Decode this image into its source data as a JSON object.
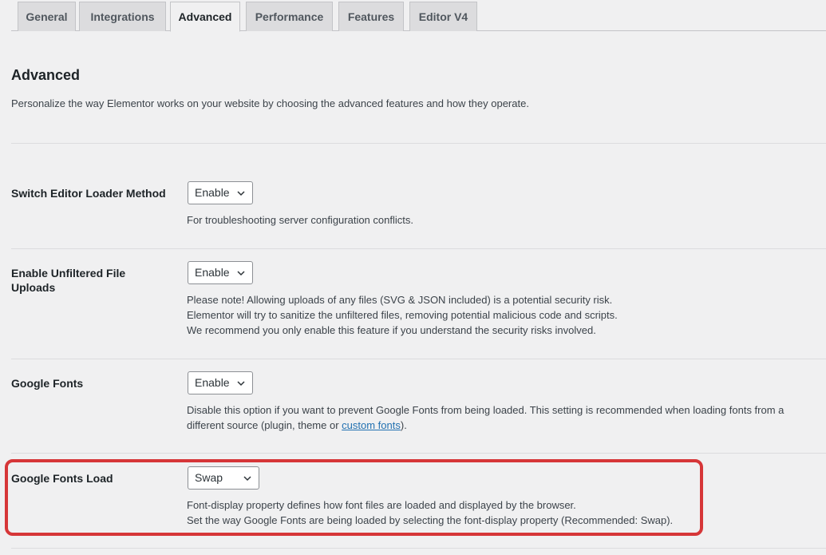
{
  "tabs": [
    {
      "label": "General"
    },
    {
      "label": "Integrations"
    },
    {
      "label": "Advanced"
    },
    {
      "label": "Performance"
    },
    {
      "label": "Features"
    },
    {
      "label": "Editor V4"
    }
  ],
  "section": {
    "title": "Advanced",
    "description": "Personalize the way Elementor works on your website by choosing the advanced features and how they operate."
  },
  "settings": {
    "editor_loader": {
      "label": "Switch Editor Loader Method",
      "value": "Enable",
      "help": "For troubleshooting server configuration conflicts."
    },
    "unfiltered_uploads": {
      "label_line1": "Enable Unfiltered File",
      "label_line2": "Uploads",
      "value": "Enable",
      "help_line1": "Please note! Allowing uploads of any files (SVG & JSON included) is a potential security risk.",
      "help_line2": "Elementor will try to sanitize the unfiltered files, removing potential malicious code and scripts.",
      "help_line3": "We recommend you only enable this feature if you understand the security risks involved."
    },
    "google_fonts": {
      "label": "Google Fonts",
      "value": "Enable",
      "help_line1": "Disable this option if you want to prevent Google Fonts from being loaded. This setting is recommended when loading fonts from a",
      "help_line2_prefix": "different source (plugin, theme or ",
      "help_link": "custom fonts",
      "help_line2_suffix": ")."
    },
    "google_fonts_load": {
      "label": "Google Fonts Load",
      "value": "Swap",
      "help_line1": "Font-display property defines how font files are loaded and displayed by the browser.",
      "help_line2": "Set the way Google Fonts are being loaded by selecting the font-display property (Recommended: Swap)."
    }
  },
  "icons": {
    "dropdown": "chevron-down-icon"
  },
  "colors": {
    "highlight": "#d63638",
    "link": "#2271b1"
  }
}
